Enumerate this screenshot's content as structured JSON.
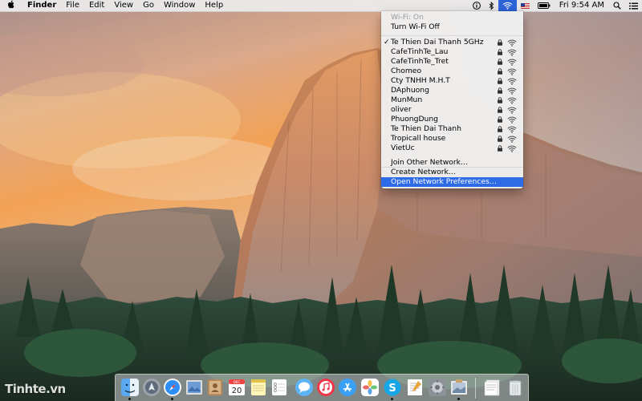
{
  "menubar": {
    "app_name": "Finder",
    "menus": [
      "File",
      "Edit",
      "View",
      "Go",
      "Window",
      "Help"
    ],
    "clock": "Fri 9:54 AM"
  },
  "wifi_menu": {
    "status": "Wi-Fi: On",
    "toggle": "Turn Wi-Fi Off",
    "connected_check": "✓",
    "networks": [
      {
        "name": "Te Thien Dai Thanh 5GHz",
        "connected": true
      },
      {
        "name": "CafeTinhTe_Lau"
      },
      {
        "name": "CafeTinhTe_Tret"
      },
      {
        "name": "Chomeo"
      },
      {
        "name": "Cty TNHH M.H.T"
      },
      {
        "name": "DAphuong"
      },
      {
        "name": "MunMun"
      },
      {
        "name": "oliver"
      },
      {
        "name": "PhuongDung"
      },
      {
        "name": "Te Thien Dai Thanh"
      },
      {
        "name": "Tropicall house"
      },
      {
        "name": "VietUc"
      }
    ],
    "actions": [
      "Join Other Network…",
      "Create Network…",
      "Open Network Preferences…"
    ],
    "highlight_color": "#2e6be6"
  },
  "dock": {
    "apps": [
      "Finder",
      "Launchpad",
      "Safari",
      "Preview",
      "Contacts",
      "Calendar",
      "Notes",
      "Reminders",
      "Messages",
      "iTunes",
      "App Store",
      "Photos",
      "Skype",
      "TextEdit",
      "System Preferences",
      "Preview Gallery",
      "Stacks",
      "Trash"
    ],
    "calendar_month": "DEC",
    "calendar_day": "20"
  },
  "watermark": "Tinhte.vn"
}
